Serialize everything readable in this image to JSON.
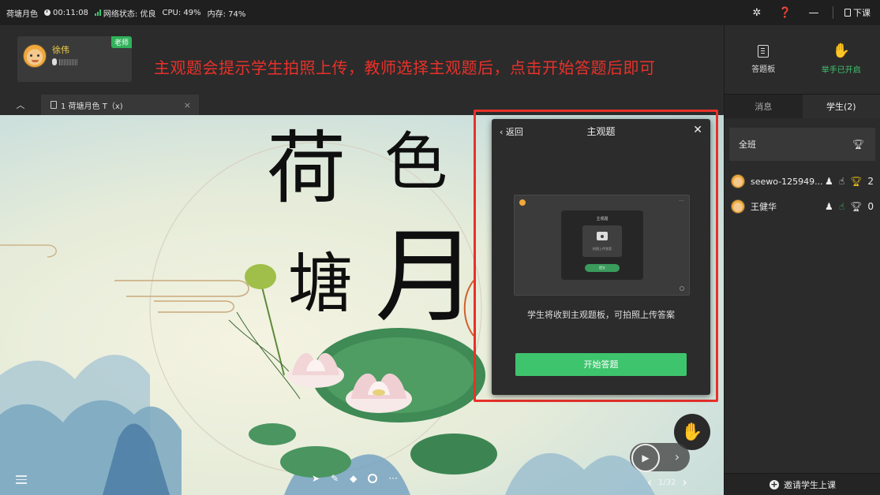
{
  "titlebar": {
    "app_title": "荷塘月色",
    "timer": "00:11:08",
    "network": "网络状态: 优良",
    "cpu": "CPU: 49%",
    "memory": "内存: 74%",
    "leave_label": "下课"
  },
  "teacher": {
    "name": "徐伟",
    "badge": "老师"
  },
  "annotation": "主观题会提示学生拍照上传，教师选择主观题后，点击开始答题后即可",
  "doc_tab": {
    "title": "1 荷塘月色 T（x)"
  },
  "slide": {
    "chars": [
      "荷",
      "色",
      "塘",
      "月"
    ]
  },
  "modal": {
    "back_label": "返回",
    "title": "主观题",
    "preview": {
      "card_title": "主观题",
      "upload_label": "拍照上传答案",
      "submit_label": "提交"
    },
    "description": "学生将收到主观题板，可拍照上传答案",
    "start_button": "开始答题"
  },
  "right_panel": {
    "tools": [
      {
        "label": "答题板",
        "icon": "answer-board-icon"
      },
      {
        "label": "举手已开启",
        "icon": "raise-hand-icon"
      }
    ],
    "tabs": [
      "消息",
      "学生(2)"
    ],
    "class_row": "全班",
    "students": [
      {
        "name": "seewo-125949...",
        "trophy_count": "2"
      },
      {
        "name": "王健华",
        "trophy_count": "0"
      }
    ],
    "invite_label": "邀请学生上课"
  },
  "controls": {
    "page_indicator": "1/32"
  },
  "colors": {
    "accent_green": "#3ec46d",
    "annotation_red": "#e8312a",
    "teacher_gold": "#f4d245"
  }
}
